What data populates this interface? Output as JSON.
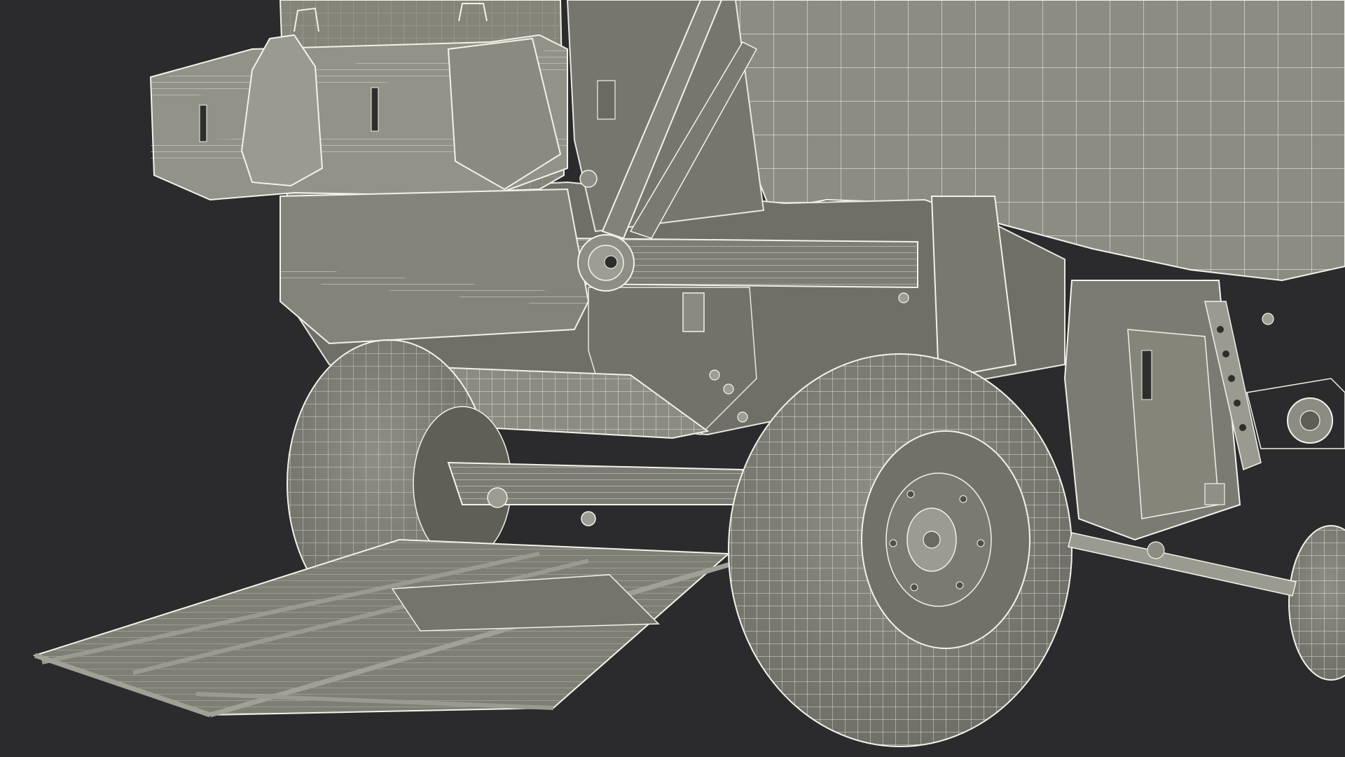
{
  "scene": {
    "subject": "round-baler-wireframe-render",
    "background_color": "#2b2b2d",
    "surface_color": "#8a8a80",
    "surface_dark_color": "#6e6e66",
    "wire_color": "#f2f2ea",
    "shadow_color": "#55554f"
  }
}
